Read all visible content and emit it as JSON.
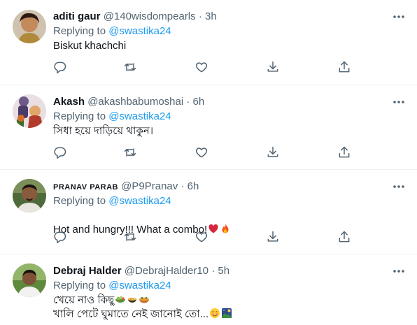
{
  "replies": [
    {
      "name": "aditi gaur",
      "handle": "@140wisdompearls",
      "dot": "·",
      "time": "3h",
      "replying_prefix": "Replying to",
      "replying_to": "@swastika24",
      "text": "Biskut khachchi"
    },
    {
      "name": "Akash",
      "handle": "@akashbabumoshai",
      "dot": "·",
      "time": "6h",
      "replying_prefix": "Replying to",
      "replying_to": "@swastika24",
      "text": "সিধা হয়ে দাড়িয়ে থাকুন।"
    },
    {
      "name": "PRANAV PARAB",
      "handle": "@P9Pranav",
      "dot": "·",
      "time": "6h",
      "replying_prefix": "Replying to",
      "replying_to": "@swastika24",
      "text": "Hot and hungry!!! What a combo!"
    },
    {
      "name": "Debraj Halder",
      "handle": "@DebrajHalder10",
      "dot": "·",
      "time": "5h",
      "replying_prefix": "Replying to",
      "replying_to": "@swastika24",
      "text_line1": "খেয়ে নাও কিছু",
      "text_line2": "খালি পেটে ঘুমাতে নেই জানোই তো..."
    }
  ],
  "icons": {
    "reply": "reply-icon",
    "retweet": "retweet-icon",
    "like": "like-icon",
    "bookmark": "bookmark-icon",
    "share": "share-icon",
    "more": "more-options-icon"
  },
  "colors": {
    "text": "#0f1419",
    "secondary": "#536471",
    "link": "#1d9bf0",
    "divider": "#eff3f4"
  }
}
